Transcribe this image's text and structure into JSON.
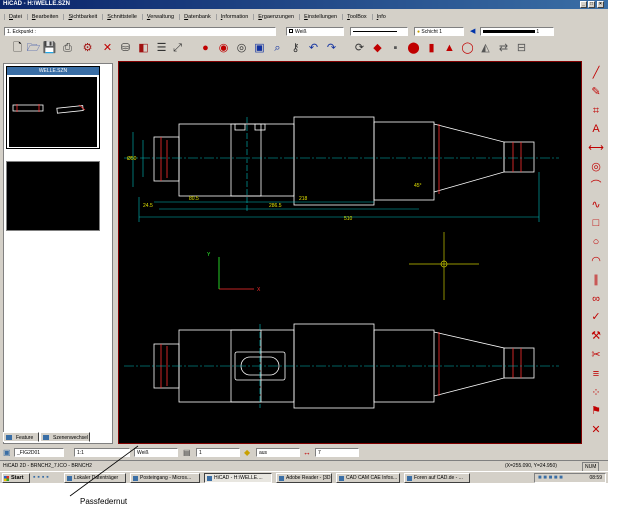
{
  "window": {
    "title": "HiCAD - H:\\WELLE.SZN",
    "minimize": "_",
    "maximize": "□",
    "close": "×"
  },
  "menu": [
    "Datei",
    "Bearbeiten",
    "Sichtbarkeit",
    "Schnittstelle",
    "Verwaltung",
    "Datenbank",
    "Information",
    "Ergaenzungen",
    "Einstellungen",
    "ToolBox",
    "Info"
  ],
  "command_prompt": "1. Eckpunkt :",
  "layer_color": "Weiß",
  "layer_label": "Schicht",
  "layer_value": "1",
  "line_width_value": "1",
  "browser": {
    "title": "WELLE.SZN"
  },
  "tabs": {
    "feature": "Feature",
    "szenenwechsel": "Szenenwechsel"
  },
  "bottom_fields": {
    "figure": "_FIG2D01",
    "scale": "1:1",
    "color": "Weiß",
    "value1": "1",
    "layer": "aus",
    "value2": "7"
  },
  "status": {
    "left": "HiCAD 2D - BRNCH2_7.ICO - BRNCH2",
    "coords": "(X=255.090, Y=24.950)",
    "num": "NUM"
  },
  "taskbar": {
    "start": "Start",
    "tasks": [
      "Lokaler Datenträger",
      "Posteingang - Micros...",
      "HiCAD - H:\\WELLE....",
      "Adobe Reader - [3D...",
      "CAD CAM CAE Infos...",
      "Foren auf CAD.de - ..."
    ],
    "clock": "08:59"
  },
  "drawing": {
    "dims": [
      "Ø50",
      "80.5",
      "218",
      "24.5",
      "286.5",
      "510",
      "45°"
    ],
    "axis_x": "X",
    "axis_y": "Y"
  },
  "annotation": "Passfedernut"
}
